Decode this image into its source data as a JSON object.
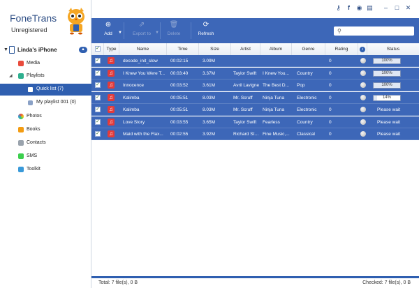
{
  "app": {
    "title": "FoneTrans",
    "subtitle": "Unregistered"
  },
  "device": {
    "name": "Linda's iPhone"
  },
  "sidebar": {
    "items": [
      {
        "label": "Media",
        "icon": "media-icon"
      },
      {
        "label": "Playlists",
        "icon": "playlists-icon"
      },
      {
        "label": "Quick list (7)",
        "icon": "quick-list-icon",
        "selected": true
      },
      {
        "label": "My playlist 001 (0)",
        "icon": "playlist-icon"
      },
      {
        "label": "Photos",
        "icon": "photos-icon"
      },
      {
        "label": "Books",
        "icon": "books-icon"
      },
      {
        "label": "Contacts",
        "icon": "contacts-icon"
      },
      {
        "label": "SMS",
        "icon": "sms-icon"
      },
      {
        "label": "Toolkit",
        "icon": "toolkit-icon"
      }
    ]
  },
  "toolbar": {
    "add": "Add",
    "export": "Export to",
    "delete": "Delete",
    "refresh": "Refresh"
  },
  "table": {
    "headers": {
      "type": "Type",
      "name": "Name",
      "time": "Time",
      "size": "Size",
      "artist": "Artist",
      "album": "Album",
      "genre": "Genre",
      "rating": "Rating",
      "status": "Status"
    },
    "rows": [
      {
        "name": "decode_init_slow",
        "time": "00:02:15",
        "size": "3.09M",
        "artist": "",
        "album": "",
        "genre": "",
        "rating": "0",
        "status_type": "progress",
        "status": "100%",
        "progress": 1.0
      },
      {
        "name": "I Knew You Were T...",
        "time": "00:03:40",
        "size": "3.37M",
        "artist": "Taylor Swift",
        "album": "I Knew You...",
        "genre": "Country",
        "rating": "0",
        "status_type": "progress",
        "status": "100%",
        "progress": 1.0
      },
      {
        "name": "Innocence",
        "time": "00:03:52",
        "size": "3.61M",
        "artist": "Avril Lavigne",
        "album": "The Best D...",
        "genre": "Pop",
        "rating": "0",
        "status_type": "progress",
        "status": "100%",
        "progress": 1.0
      },
      {
        "name": "Kalimba",
        "time": "00:05:51",
        "size": "8.03M",
        "artist": "Mr. Scruff",
        "album": "Ninja Tuna",
        "genre": "Electronic",
        "rating": "0",
        "status_type": "progress",
        "status": "14%",
        "progress": 0.14
      },
      {
        "name": "Kalimba",
        "time": "00:05:51",
        "size": "8.03M",
        "artist": "Mr. Scruff",
        "album": "Ninja Tuna",
        "genre": "Electronic",
        "rating": "0",
        "status_type": "text",
        "status": "Please wait"
      },
      {
        "name": "Love Story",
        "time": "00:03:55",
        "size": "3.65M",
        "artist": "Taylor Swift",
        "album": "Fearless",
        "genre": "Country",
        "rating": "0",
        "status_type": "text",
        "status": "Please wait"
      },
      {
        "name": "Maid with the Flax...",
        "time": "00:02:55",
        "size": "3.92M",
        "artist": "Richard Sto...",
        "album": "Fine Music,...",
        "genre": "Classical",
        "rating": "0",
        "status_type": "text",
        "status": "Please wait"
      }
    ]
  },
  "footer": {
    "total": "Total: 7 file(s), 0 B",
    "checked": "Checked: 7 file(s), 0 B"
  },
  "colors": {
    "accent": "#3d67b8",
    "selected": "#2f5fb0",
    "music_icon": "#e23b3b"
  }
}
